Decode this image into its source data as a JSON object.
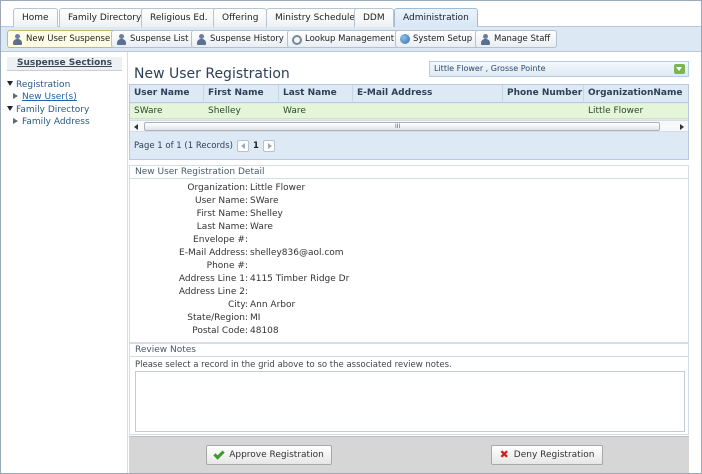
{
  "tabs": [
    {
      "label": "Home"
    },
    {
      "label": "Family Directory"
    },
    {
      "label": "Religious Ed."
    },
    {
      "label": "Offering"
    },
    {
      "label": "Ministry Scheduler"
    },
    {
      "label": "DDM"
    },
    {
      "label": "Administration",
      "active": true
    }
  ],
  "toolbar": {
    "items": [
      {
        "label": "New User Suspense",
        "icon": "user-icon",
        "active": true
      },
      {
        "label": "Suspense List",
        "icon": "user-icon"
      },
      {
        "label": "Suspense History",
        "icon": "user-icon"
      },
      {
        "label": "Lookup Management",
        "icon": "gear-icon"
      },
      {
        "label": "System Setup",
        "icon": "globe-icon"
      },
      {
        "label": "Manage Staff",
        "icon": "user-icon"
      }
    ]
  },
  "sidebar": {
    "title": "Suspense Sections",
    "tree": [
      {
        "label": "Registration",
        "expanded": true
      },
      {
        "label": "New User(s)",
        "link": true
      },
      {
        "label": "Family Directory",
        "expanded": true
      },
      {
        "label": "Family Address"
      }
    ]
  },
  "main": {
    "title": "New User Registration",
    "org_selector": "Little Flower , Grosse Pointe",
    "grid": {
      "columns": [
        "User Name",
        "First Name",
        "Last Name",
        "E-Mail Address",
        "Phone Number",
        "OrganizationName"
      ],
      "rows": [
        [
          "SWare",
          "Shelley",
          "Ware",
          "",
          "",
          "Little Flower"
        ]
      ],
      "pager": {
        "text": "Page 1 of 1 (1 Records)",
        "page": "1"
      }
    },
    "detail": {
      "title": "New User Registration Detail",
      "fields": [
        {
          "label": "Organization:",
          "value": "Little Flower"
        },
        {
          "label": "User Name:",
          "value": "SWare"
        },
        {
          "label": "First Name:",
          "value": "Shelley"
        },
        {
          "label": "Last Name:",
          "value": "Ware"
        },
        {
          "label": "Envelope #:",
          "value": ""
        },
        {
          "label": "E-Mail Address:",
          "value": "shelley836@aol.com"
        },
        {
          "label": "Phone #:",
          "value": ""
        },
        {
          "label": "Address Line 1:",
          "value": "4115 Timber Ridge Dr"
        },
        {
          "label": "Address Line 2:",
          "value": ""
        },
        {
          "label": "City:",
          "value": "Ann Arbor"
        },
        {
          "label": "State/Region:",
          "value": "MI"
        },
        {
          "label": "Postal Code:",
          "value": "48108"
        }
      ]
    },
    "review": {
      "title": "Review Notes",
      "message": "Please select a record in the grid above to so the associated review notes."
    },
    "actions": {
      "approve": "Approve Registration",
      "deny": "Deny Registration"
    }
  }
}
